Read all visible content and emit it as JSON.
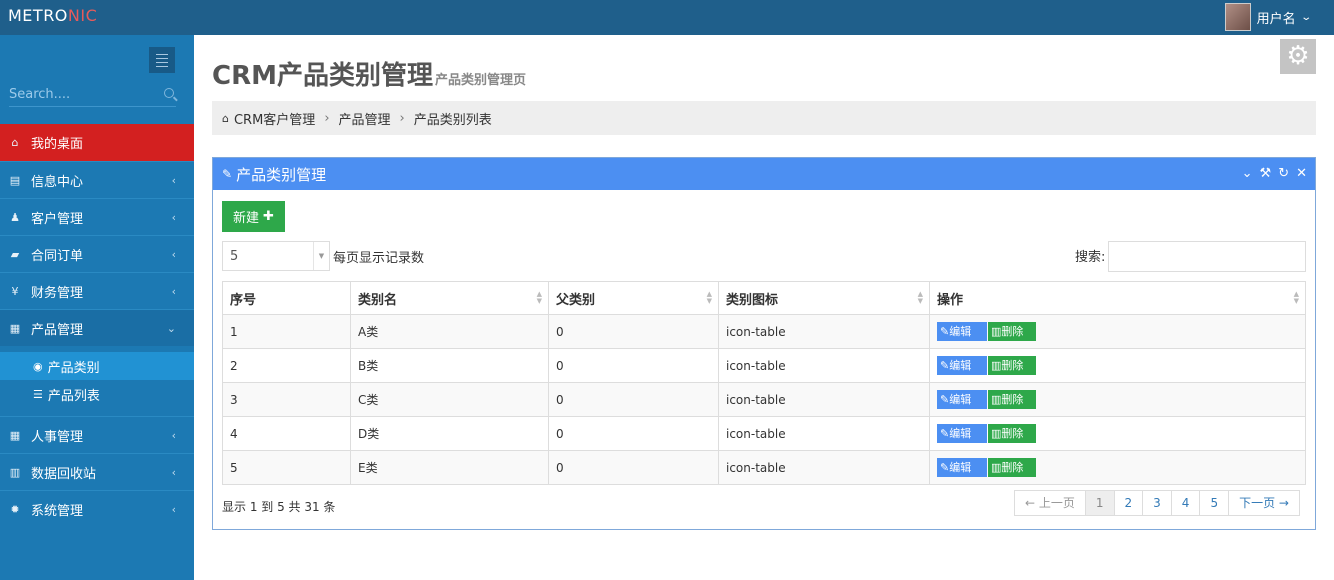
{
  "brand": {
    "part1": "METRO",
    "part2": "NIC"
  },
  "user": {
    "name": "用户名"
  },
  "sidebar": {
    "search_placeholder": "Search....",
    "items": [
      {
        "label": "我的桌面",
        "icon": "home-icon"
      },
      {
        "label": "信息中心",
        "icon": "inbox-icon"
      },
      {
        "label": "客户管理",
        "icon": "user-icon"
      },
      {
        "label": "合同订单",
        "icon": "book-icon"
      },
      {
        "label": "财务管理",
        "icon": "yen-icon"
      },
      {
        "label": "产品管理",
        "icon": "table-icon"
      },
      {
        "label": "人事管理",
        "icon": "table-icon"
      },
      {
        "label": "数据回收站",
        "icon": "trash-icon"
      },
      {
        "label": "系统管理",
        "icon": "gear-icon"
      }
    ],
    "submenu": [
      {
        "label": "产品类别"
      },
      {
        "label": "产品列表"
      }
    ]
  },
  "page": {
    "title": "CRM产品类别管理",
    "subtitle": "产品类别管理页"
  },
  "breadcrumb": [
    "CRM客户管理",
    "产品管理",
    "产品类别列表"
  ],
  "portlet": {
    "title": "产品类别管理",
    "new_button": "新建",
    "page_size": "5",
    "page_size_label": "每页显示记录数",
    "search_label": "搜索:"
  },
  "table": {
    "headers": [
      "序号",
      "类别名",
      "父类别",
      "类别图标",
      "操作"
    ],
    "rows": [
      [
        "1",
        "A类",
        "0",
        "icon-table"
      ],
      [
        "2",
        "B类",
        "0",
        "icon-table"
      ],
      [
        "3",
        "C类",
        "0",
        "icon-table"
      ],
      [
        "4",
        "D类",
        "0",
        "icon-table"
      ],
      [
        "5",
        "E类",
        "0",
        "icon-table"
      ]
    ],
    "edit_label": "编辑",
    "delete_label": "删除"
  },
  "footer": {
    "info": "显示 1 到 5 共 31 条",
    "prev": "← 上一页",
    "pages": [
      "1",
      "2",
      "3",
      "4",
      "5"
    ],
    "next": "下一页 →"
  },
  "colors": {
    "topbar": "#1f5f8b",
    "sidebar": "#1c79b3",
    "active": "#d32020",
    "portlet_head": "#4c8ff2",
    "green": "#2ea84a"
  }
}
